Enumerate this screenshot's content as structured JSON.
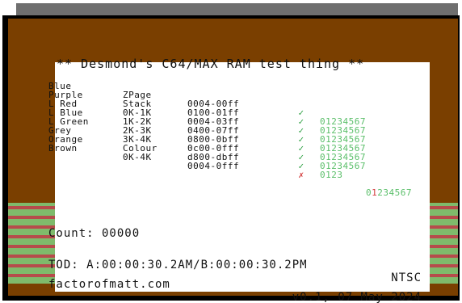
{
  "app": {
    "title": "** Desmond's C64/MAX RAM test thing **"
  },
  "ram_rows": [
    {
      "color": "Blue",
      "type": "ZPage",
      "range": "0004-00ff",
      "status": "✓",
      "status_kind": "ok",
      "bits": "01234567",
      "bad_bits": []
    },
    {
      "color": "Purple",
      "type": "Stack",
      "range": "0100-01ff",
      "status": "✓",
      "status_kind": "ok",
      "bits": "01234567",
      "bad_bits": []
    },
    {
      "color": "L Red",
      "type": "0K-1K",
      "range": "0004-03ff",
      "status": "✓",
      "status_kind": "ok",
      "bits": "01234567",
      "bad_bits": []
    },
    {
      "color": "L Blue",
      "type": "1K-2K",
      "range": "0400-07ff",
      "status": "✓",
      "status_kind": "ok",
      "bits": "01234567",
      "bad_bits": []
    },
    {
      "color": "L Green",
      "type": "2K-3K",
      "range": "0800-0bff",
      "status": "✓",
      "status_kind": "ok",
      "bits": "01234567",
      "bad_bits": []
    },
    {
      "color": "Grey",
      "type": "3K-4K",
      "range": "0c00-0fff",
      "status": "✓",
      "status_kind": "ok",
      "bits": "01234567",
      "bad_bits": []
    },
    {
      "color": "Orange",
      "type": "Colour",
      "range": "d800-dbff",
      "status": "✓",
      "status_kind": "ok",
      "bits": "0123",
      "bad_bits": []
    },
    {
      "color": "Brown",
      "type": "0K-4K",
      "range": "0004-0fff",
      "status": "✗",
      "status_kind": "bad",
      "bits": "01234567",
      "bad_bits": [
        1
      ]
    }
  ],
  "footer": {
    "count": "Count: 00000",
    "tod_left": "TOD: A:00:00:30.2AM/B:00:00:30.2PM",
    "tod_right": "NTSC",
    "site_left": "factorofmatt.com",
    "site_right": "v0.1, 07 May 2024"
  },
  "colors": {
    "brown_bg": "#7a3f00",
    "stripe_green": "#7fba6b",
    "stripe_red": "#b64b4b",
    "ok": "#2ea043",
    "bad": "#d33c3c"
  }
}
